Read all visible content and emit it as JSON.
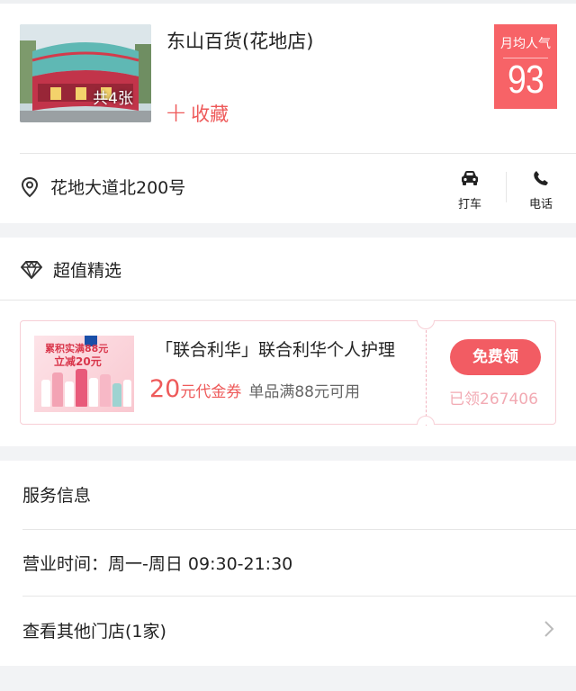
{
  "store": {
    "name": "东山百货(花地店)",
    "photo_count": "共4张",
    "favorite_label": "收藏",
    "popularity_label": "月均人气",
    "popularity_value": "93",
    "address": "花地大道北200号",
    "actions": [
      {
        "label": "打车",
        "icon": "car-icon"
      },
      {
        "label": "电话",
        "icon": "phone-icon"
      }
    ]
  },
  "featured": {
    "title": "超值精选",
    "icon": "diamond-icon",
    "coupon": {
      "title": "「联合利华」联合利华个人护理",
      "amount": "20",
      "unit": "元代金券",
      "condition": "单品满88元可用",
      "button_label": "免费领",
      "claimed": "已领267406",
      "image_text_1": "累积实满88元",
      "image_text_2": "立减20元"
    }
  },
  "service": {
    "title": "服务信息",
    "hours": "营业时间：周一-周日 09:30-21:30",
    "other_stores": "查看其他门店(1家)"
  },
  "colors": {
    "accent": "#ee5a5a",
    "popularity_bg": "#f76367",
    "button_bg": "#f25c63",
    "claimed_text": "#f2aab3"
  }
}
